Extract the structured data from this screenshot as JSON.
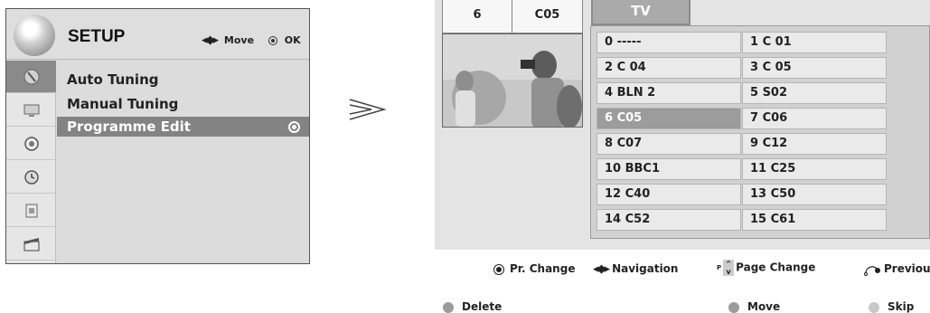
{
  "setup_menu": {
    "title": "SETUP",
    "hint_move": "Move",
    "hint_ok": "OK",
    "side_icons": [
      "antenna-icon",
      "picture-icon",
      "audio-icon",
      "time-icon",
      "option-icon",
      "lock-icon"
    ],
    "items": [
      {
        "label": "Auto Tuning",
        "selected": false
      },
      {
        "label": "Manual Tuning",
        "selected": false
      },
      {
        "label": "Programme Edit",
        "selected": true
      }
    ]
  },
  "programme_edit": {
    "current_number": "6",
    "current_channel": "C05",
    "source_tab": "TV",
    "selected_programme": "6 C05",
    "programmes": [
      "0 -----",
      "1 C 01",
      "2 C 04",
      "3 C 05",
      "4 BLN 2",
      "5 S02",
      "6 C05",
      "7 C06",
      "8 C07",
      "9 C12",
      "10 BBC1",
      "11 C25",
      "12 C40",
      "13 C50",
      "14 C52",
      "15 C61"
    ]
  },
  "legend": {
    "pr_change": "Pr. Change",
    "navigation": "Navigation",
    "page_change_prefix": "P",
    "page_change": "Page Change",
    "previous": "Previous",
    "delete": "Delete",
    "move": "Move",
    "skip": "Skip"
  },
  "colors": {
    "selection": "#838383",
    "highlight_cell": "#9c9c9c",
    "panel_bg": "#e4e4e4"
  }
}
